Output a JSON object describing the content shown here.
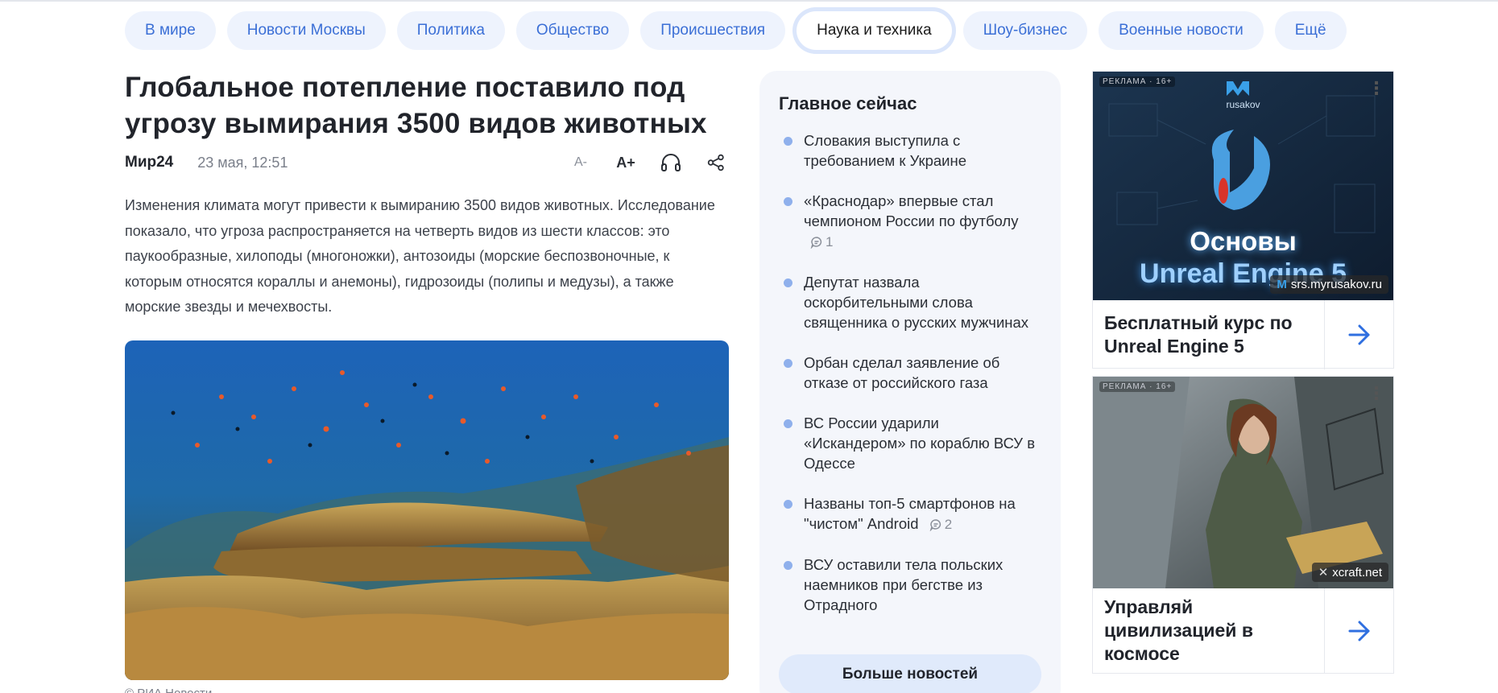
{
  "tabs": [
    {
      "label": "В мире",
      "active": false
    },
    {
      "label": "Новости Москвы",
      "active": false
    },
    {
      "label": "Политика",
      "active": false
    },
    {
      "label": "Общество",
      "active": false
    },
    {
      "label": "Происшествия",
      "active": false
    },
    {
      "label": "Наука и техника",
      "active": true
    },
    {
      "label": "Шоу-бизнес",
      "active": false
    },
    {
      "label": "Военные новости",
      "active": false
    },
    {
      "label": "Ещё",
      "active": false
    }
  ],
  "article": {
    "title": "Глобальное потепление поставило под угрозу вымирания 3500 видов животных",
    "source": "Мир24",
    "date": "23 мая, 12:51",
    "font_decrease": "A-",
    "font_increase": "A+",
    "lead": "Изменения климата могут привести к вымиранию 3500 видов животных. Исследование показало, что угроза распространяется на четверть видов из шести классов: это паукообразные, хилоподы (многоножки), антозоиды (морские беспозвоночные, к которым относятся кораллы и анемоны), гидрозоиды (полипы и медузы), а также морские звезды и мечехвосты.",
    "photo_credit": "© РИА Новости",
    "icons": [
      "headphones-icon",
      "share-icon"
    ]
  },
  "main_now": {
    "heading": "Главное сейчас",
    "items": [
      {
        "text": "Словакия выступила с требованием к Украине",
        "comments": ""
      },
      {
        "text": "«Краснодар» впервые стал чемпионом России по футболу",
        "comments": "1"
      },
      {
        "text": "Депутат назвала оскорбительными слова священника о русских мужчинах",
        "comments": ""
      },
      {
        "text": "Орбан сделал заявление об отказе от российского газа",
        "comments": ""
      },
      {
        "text": "ВС России ударили «Искандером» по кораблю ВСУ в Одессе",
        "comments": ""
      },
      {
        "text": "Названы топ-5 смартфонов на \"чистом\" Android",
        "comments": "2"
      },
      {
        "text": "ВСУ оставили тела польских наемников при бегстве из Отрадного",
        "comments": ""
      }
    ],
    "more_button": "Больше новостей"
  },
  "ads": [
    {
      "label": "РЕКЛАМА · 16+",
      "image_brand": "rusakov",
      "image_line1": "Основы",
      "image_line2": "Unreal Engine 5",
      "domain": "srs.myrusakov.ru",
      "text": "Бесплатный курс по Unreal Engine 5"
    },
    {
      "label": "РЕКЛАМА · 16+",
      "domain": "xcraft.net",
      "text": "Управляй цивилизацией в космосе"
    }
  ],
  "colors": {
    "accent": "#3b6fd6",
    "tab_bg": "#eef3fd",
    "sidebar_bg": "#f4f6fb",
    "button_bg": "#e0eafb",
    "arrow": "#2f6fe0"
  }
}
